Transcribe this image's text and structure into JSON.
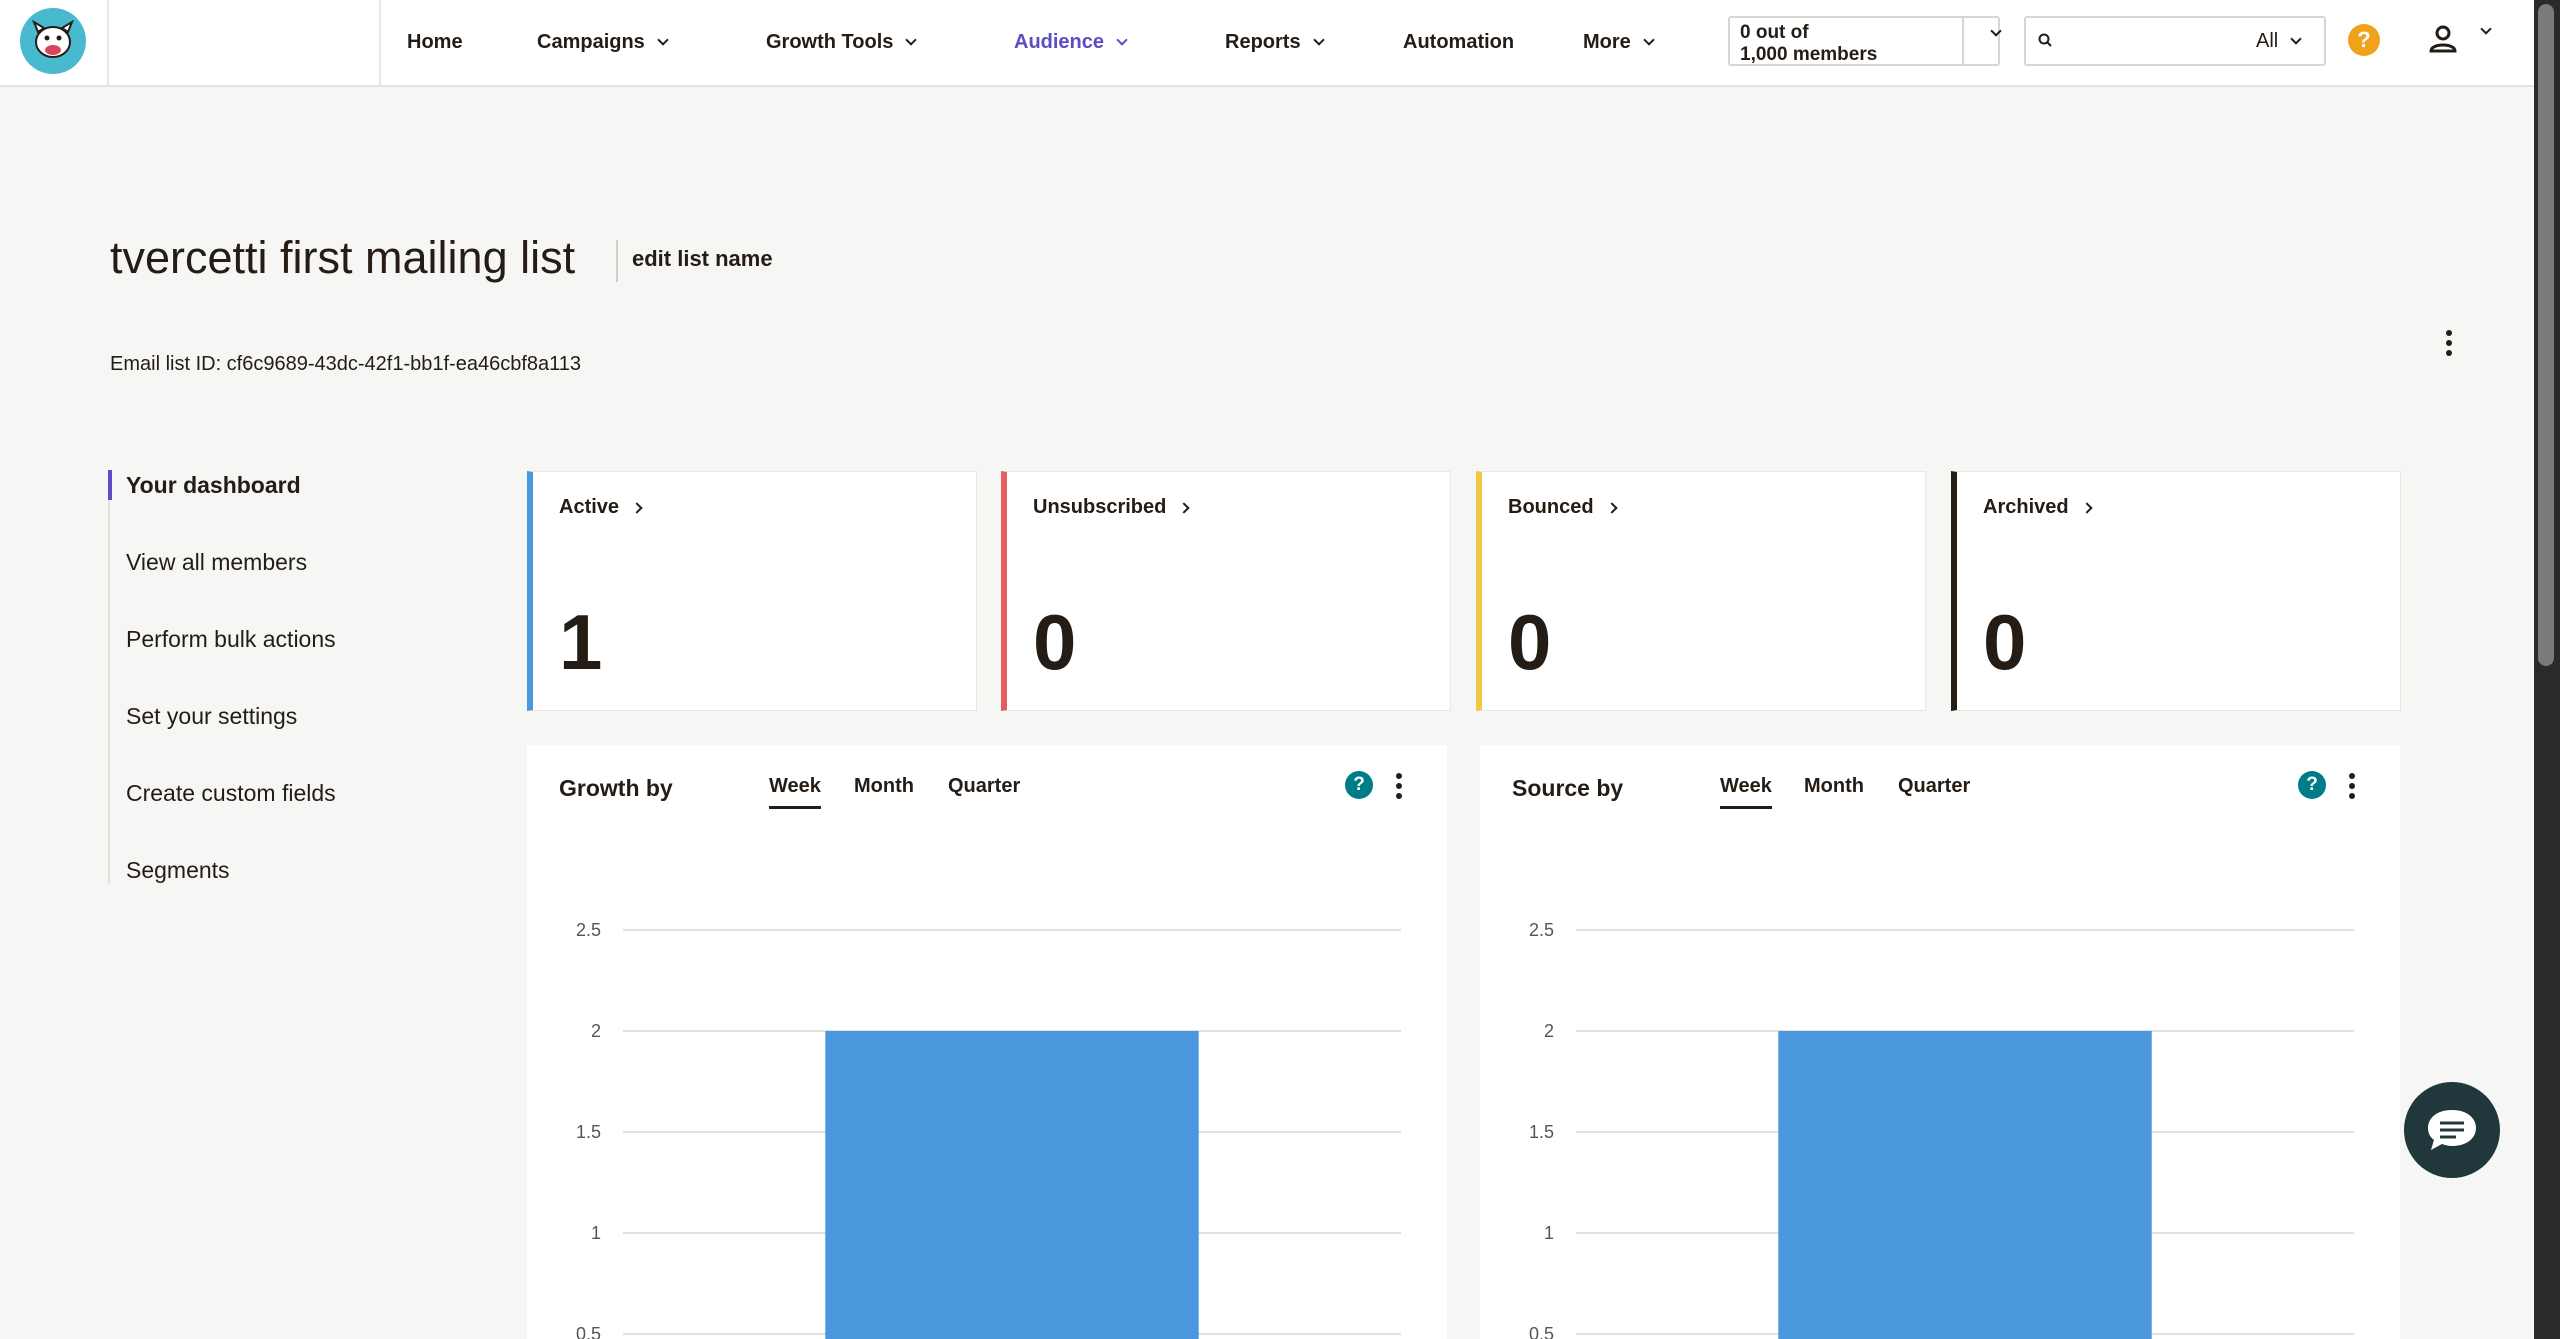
{
  "nav": {
    "items": [
      {
        "label": "Home",
        "has_menu": false
      },
      {
        "label": "Campaigns",
        "has_menu": true
      },
      {
        "label": "Growth Tools",
        "has_menu": true
      },
      {
        "label": "Audience",
        "has_menu": true,
        "active": true
      },
      {
        "label": "Reports",
        "has_menu": true
      },
      {
        "label": "Automation",
        "has_menu": false
      },
      {
        "label": "More",
        "has_menu": true
      }
    ],
    "members_line1": "0 out of",
    "members_line2": "1,000 members",
    "search_placeholder": "",
    "search_scope": "All",
    "help_label": "?"
  },
  "header": {
    "title": "tvercetti first mailing list",
    "edit_label": "edit list name",
    "list_id": "Email list ID: cf6c9689-43dc-42f1-bb1f-ea46cbf8a113"
  },
  "sidebar": {
    "items": [
      {
        "label": "Your dashboard",
        "current": true
      },
      {
        "label": "View all members"
      },
      {
        "label": "Perform bulk actions"
      },
      {
        "label": "Set your settings"
      },
      {
        "label": "Create custom fields"
      },
      {
        "label": "Segments"
      }
    ]
  },
  "stats": [
    {
      "label": "Active",
      "value": "1",
      "color": "#4a97dd"
    },
    {
      "label": "Unsubscribed",
      "value": "0",
      "color": "#e15f5f"
    },
    {
      "label": "Bounced",
      "value": "0",
      "color": "#f2c744"
    },
    {
      "label": "Archived",
      "value": "0",
      "color": "#241c15"
    }
  ],
  "panels": [
    {
      "title": "Growth by",
      "tabs": [
        "Week",
        "Month",
        "Quarter"
      ],
      "selected_tab": "Week"
    },
    {
      "title": "Source by",
      "tabs": [
        "Week",
        "Month",
        "Quarter"
      ],
      "selected_tab": "Week"
    }
  ],
  "chart_data": [
    {
      "type": "bar",
      "title": "Growth by",
      "y_ticks": [
        "2.5",
        "2",
        "1.5",
        "1",
        "0.5"
      ],
      "ylim": [
        0,
        2.5
      ],
      "values": [
        2
      ],
      "bar_color": "#4a97dd",
      "grid": true
    },
    {
      "type": "bar",
      "title": "Source by",
      "y_ticks": [
        "2.5",
        "2",
        "1.5",
        "1",
        "0.5"
      ],
      "ylim": [
        0,
        2.5
      ],
      "values": [
        2
      ],
      "bar_color": "#4a97dd",
      "grid": true
    }
  ],
  "colors": {
    "accent": "#5b4ec2",
    "help_orange": "#f0a21b",
    "help_teal": "#007c89",
    "chat_bg": "#20383b"
  }
}
